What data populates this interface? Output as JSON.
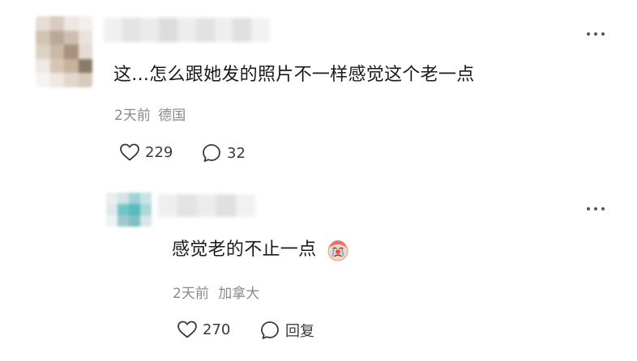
{
  "comment": {
    "text": "这...怎么跟她发的照片不一样感觉这个老一点",
    "time": "2天前",
    "location": "德国",
    "likes": "229",
    "replies": "32"
  },
  "reply": {
    "text": "感觉老的不止一点",
    "emoji_icon": "crying-clown-icon",
    "time": "2天前",
    "location": "加拿大",
    "likes": "270",
    "reply_label": "回复"
  },
  "colors": {
    "text": "#1a1a1a",
    "meta": "#8a8a8a",
    "action": "#3a3a3a",
    "avatar_reply_accent": "#6ec6c9"
  },
  "icons": {
    "like": "heart-outline-icon",
    "comment": "speech-bubble-icon",
    "more": "more-dots-icon"
  }
}
